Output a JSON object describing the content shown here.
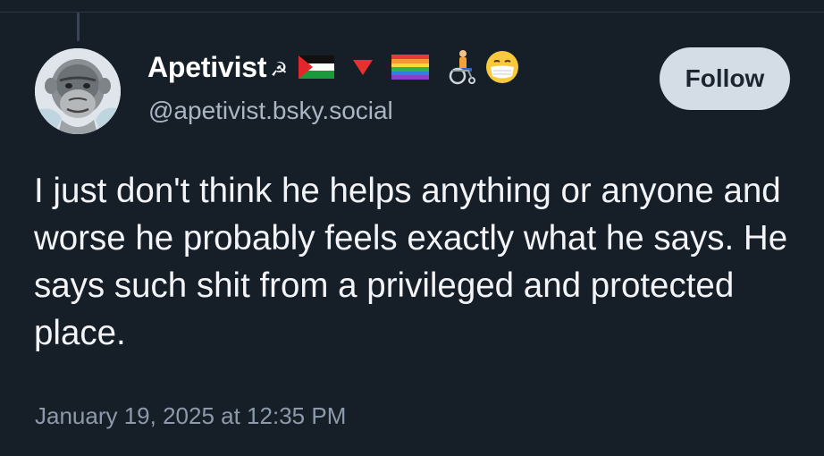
{
  "post": {
    "author": {
      "display_name": "Apetivist",
      "handle": "@apetivist.bsky.social",
      "name_emojis": [
        "hammer-and-sickle",
        "palestine-flag",
        "red-triangle",
        "rainbow-flag",
        "wheelchair-person",
        "face-with-medical-mask"
      ],
      "hammer_glyph": "☭"
    },
    "follow_label": "Follow",
    "text": "I just don't think he helps anything or anyone and worse he probably feels exactly what he says. He says such shit from a privileged and protected place.",
    "timestamp": "January 19, 2025 at 12:35 PM"
  },
  "colors": {
    "background": "#161e27",
    "follow_button_bg": "#d4dde6",
    "handle": "#aab6c4",
    "timestamp": "#8d9aab"
  }
}
